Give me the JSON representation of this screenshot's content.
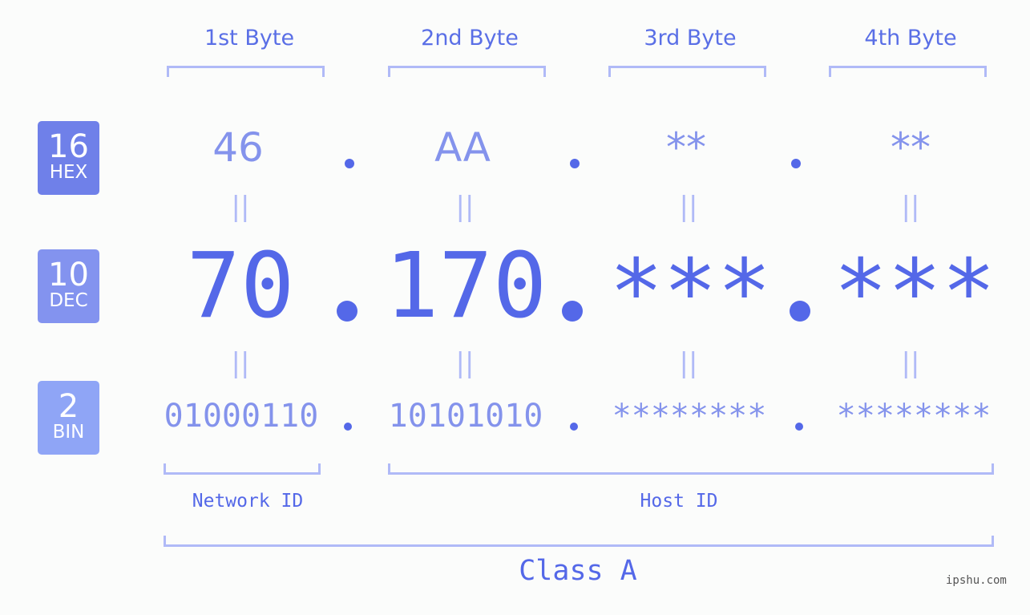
{
  "bytes": {
    "headers": [
      "1st Byte",
      "2nd Byte",
      "3rd Byte",
      "4th Byte"
    ]
  },
  "badges": {
    "hex": {
      "base": "16",
      "label": "HEX",
      "color": "#6f80e9"
    },
    "dec": {
      "base": "10",
      "label": "DEC",
      "color": "#8393ef"
    },
    "bin": {
      "base": "2",
      "label": "BIN",
      "color": "#8fa5f6"
    }
  },
  "hex": [
    "46",
    "AA",
    "**",
    "**"
  ],
  "dec": [
    "70",
    "170",
    "***",
    "***"
  ],
  "bin": [
    "01000110",
    "10101010",
    "********",
    "********"
  ],
  "equals_symbol": "||",
  "ids": {
    "network": "Network ID",
    "host": "Host ID"
  },
  "class_label": "Class A",
  "watermark": "ipshu.com",
  "colors": {
    "primary": "#5468e8",
    "light": "#8493ec",
    "bracket": "#b0baf7"
  }
}
